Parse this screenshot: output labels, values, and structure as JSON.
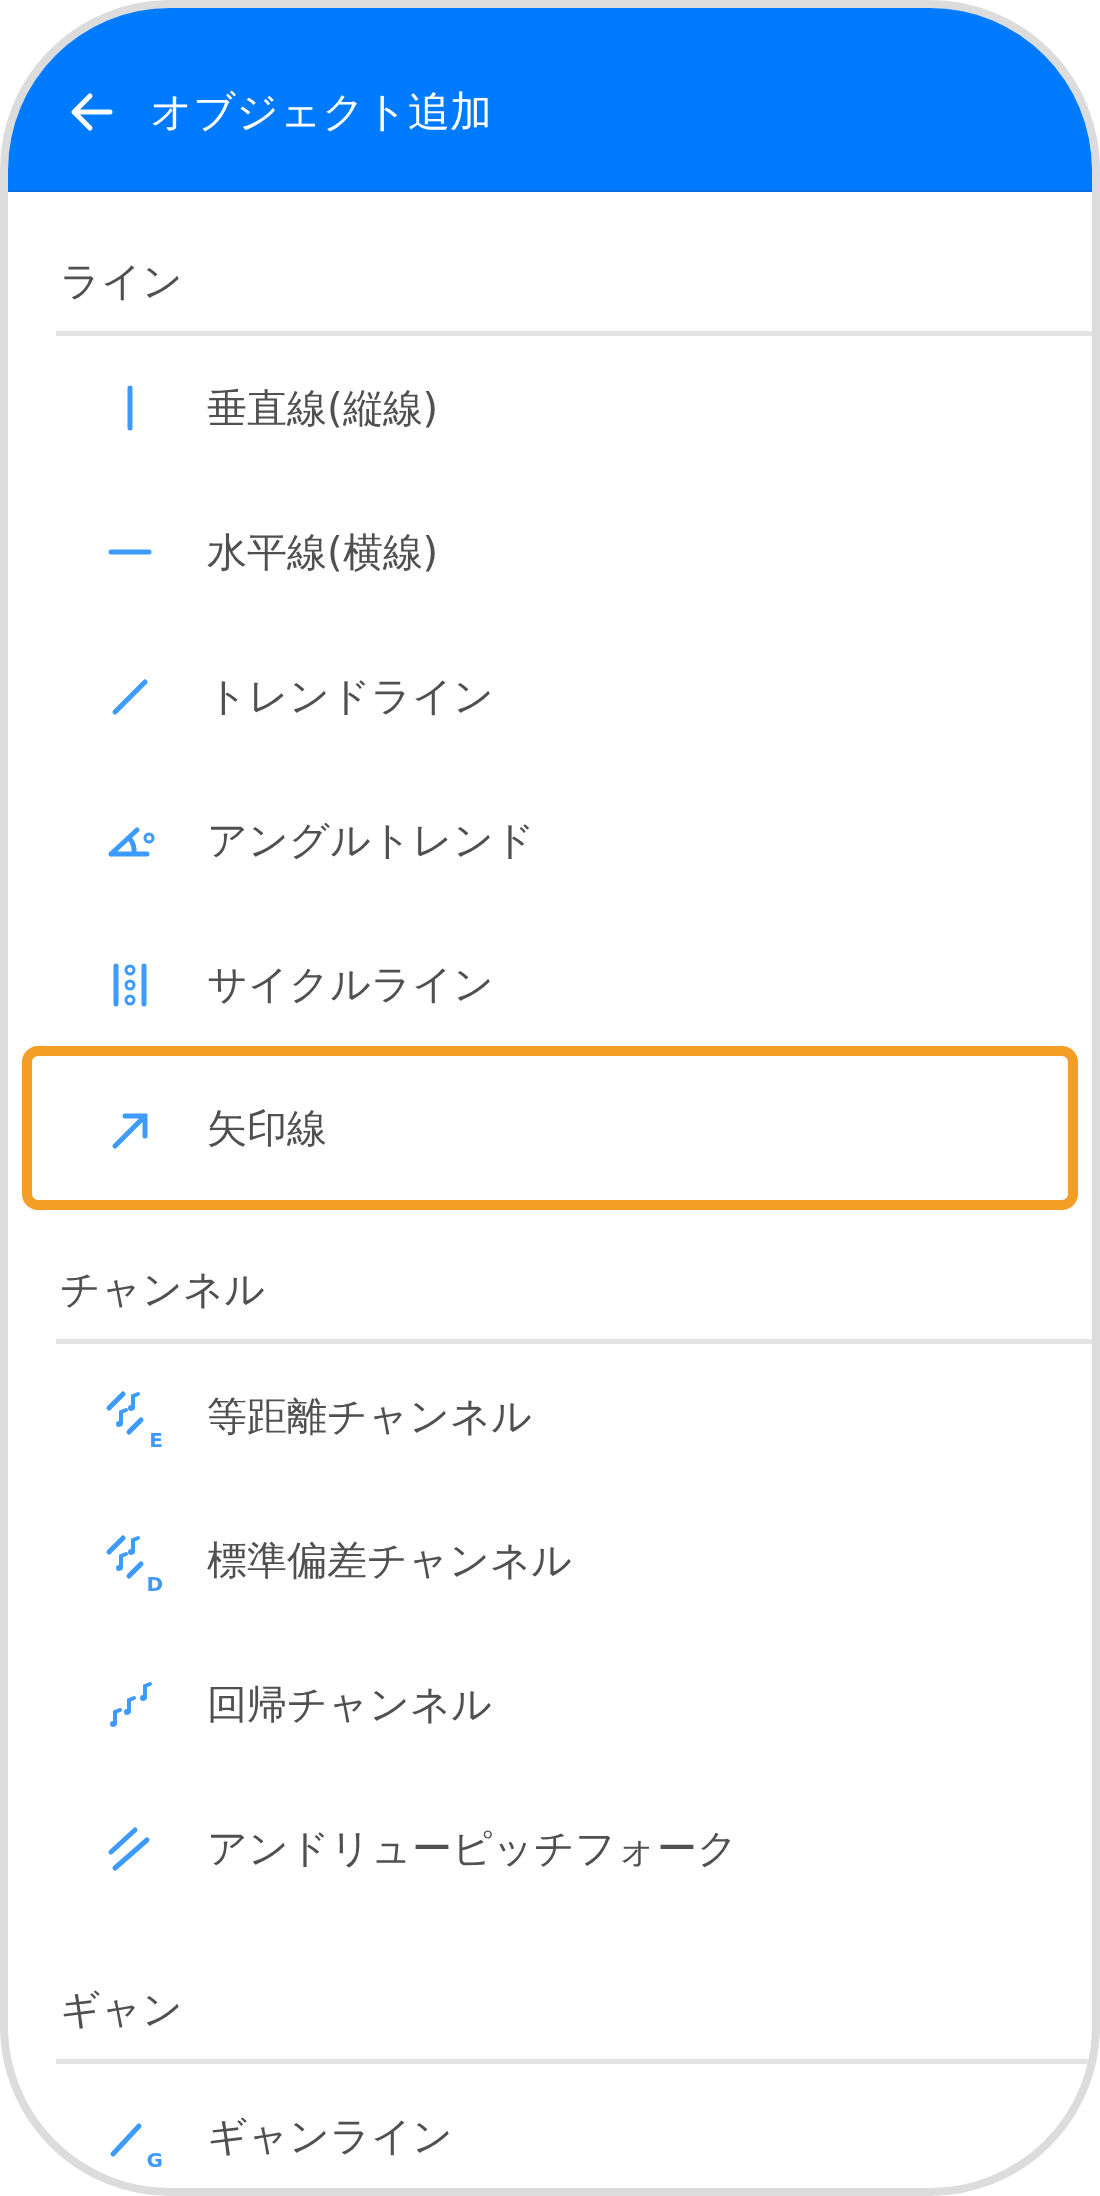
{
  "header": {
    "title": "オブジェクト追加"
  },
  "sections": [
    {
      "title": "ライン",
      "items": [
        {
          "kind": "vertical",
          "label": "垂直線(縦線)",
          "highlighted": false
        },
        {
          "kind": "horizontal",
          "label": "水平線(横線)",
          "highlighted": false
        },
        {
          "kind": "trend",
          "label": "トレンドライン",
          "highlighted": false
        },
        {
          "kind": "angle",
          "label": "アングルトレンド",
          "highlighted": false
        },
        {
          "kind": "cycle",
          "label": "サイクルライン",
          "highlighted": false
        },
        {
          "kind": "arrow",
          "label": "矢印線",
          "highlighted": true
        }
      ]
    },
    {
      "title": "チャンネル",
      "items": [
        {
          "kind": "channel",
          "icon_letter": "E",
          "label": "等距離チャンネル",
          "highlighted": false
        },
        {
          "kind": "channel",
          "icon_letter": "D",
          "label": "標準偏差チャンネル",
          "highlighted": false
        },
        {
          "kind": "regression",
          "label": "回帰チャンネル",
          "highlighted": false
        },
        {
          "kind": "pitchfork",
          "label": "アンドリューピッチフォーク",
          "highlighted": false
        }
      ]
    },
    {
      "title": "ギャン",
      "items": [
        {
          "kind": "gann",
          "icon_letter": "G",
          "label": "ギャンライン",
          "highlighted": false
        }
      ]
    }
  ]
}
